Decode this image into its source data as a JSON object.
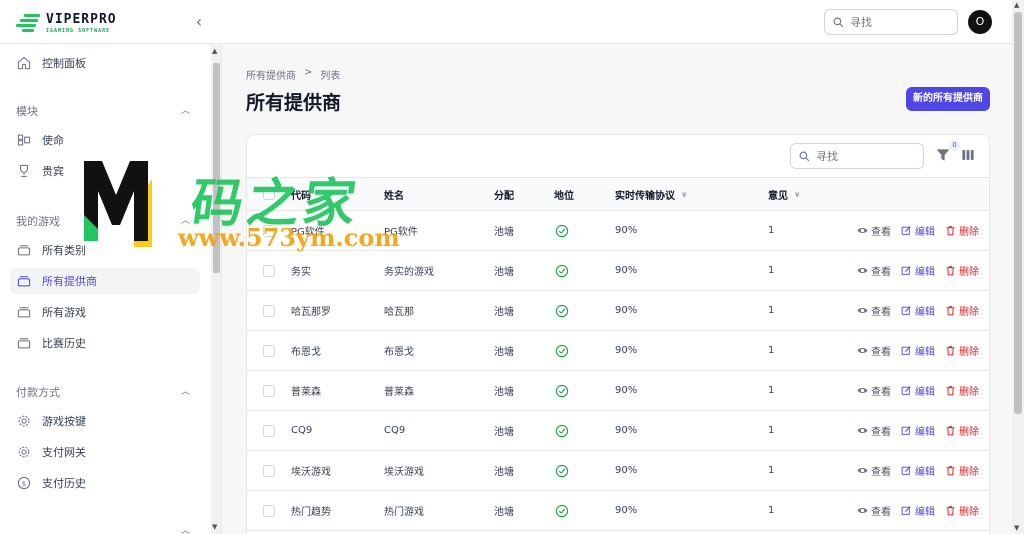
{
  "app": {
    "brand": "VIPERPRO",
    "brand_sub": "IGAMING SOFTWARE",
    "search_placeholder": "寻找",
    "avatar_letter": "O"
  },
  "sidebar": {
    "dashboard": "控制面板",
    "groups": [
      {
        "title": "模块",
        "items": [
          "使命",
          "贵宾"
        ]
      },
      {
        "title": "我的游戏",
        "items": [
          "所有类别",
          "所有提供商",
          "所有游戏",
          "比赛历史"
        ]
      },
      {
        "title": "付款方式",
        "items": [
          "游戏按键",
          "支付网关",
          "支付历史"
        ]
      }
    ],
    "active": "所有提供商"
  },
  "page": {
    "breadcrumb": [
      "所有提供商",
      "列表"
    ],
    "breadcrumb_sep": ">",
    "title": "所有提供商",
    "new_button": "新的所有提供商"
  },
  "table": {
    "search_placeholder": "寻找",
    "filter_count": "0",
    "headers": [
      "代码",
      "姓名",
      "分配",
      "地位",
      "实时传输协议",
      "意见"
    ],
    "actions": {
      "view": "查看",
      "edit": "编辑",
      "delete": "删除"
    },
    "rows": [
      {
        "code": "PG软件",
        "name": "PG软件",
        "alloc": "池塘",
        "rtp": "90%",
        "views": "1"
      },
      {
        "code": "务实",
        "name": "务实的游戏",
        "alloc": "池塘",
        "rtp": "90%",
        "views": "1"
      },
      {
        "code": "哈瓦那罗",
        "name": "哈瓦那",
        "alloc": "池塘",
        "rtp": "90%",
        "views": "1"
      },
      {
        "code": "布恩戈",
        "name": "布恩戈",
        "alloc": "池塘",
        "rtp": "90%",
        "views": "1"
      },
      {
        "code": "普莱森",
        "name": "普莱森",
        "alloc": "池塘",
        "rtp": "90%",
        "views": "1"
      },
      {
        "code": "CQ9",
        "name": "CQ9",
        "alloc": "池塘",
        "rtp": "90%",
        "views": "1"
      },
      {
        "code": "埃沃游戏",
        "name": "埃沃游戏",
        "alloc": "池塘",
        "rtp": "90%",
        "views": "1"
      },
      {
        "code": "热门趋势",
        "name": "热门游戏",
        "alloc": "池塘",
        "rtp": "90%",
        "views": "1"
      }
    ]
  },
  "watermark": {
    "text": "码之家",
    "url": "www.573ym.com"
  },
  "colors": {
    "accent": "#4f46e5",
    "success": "#16a34a",
    "danger": "#dc2626",
    "brand_green": "#22c55e"
  }
}
